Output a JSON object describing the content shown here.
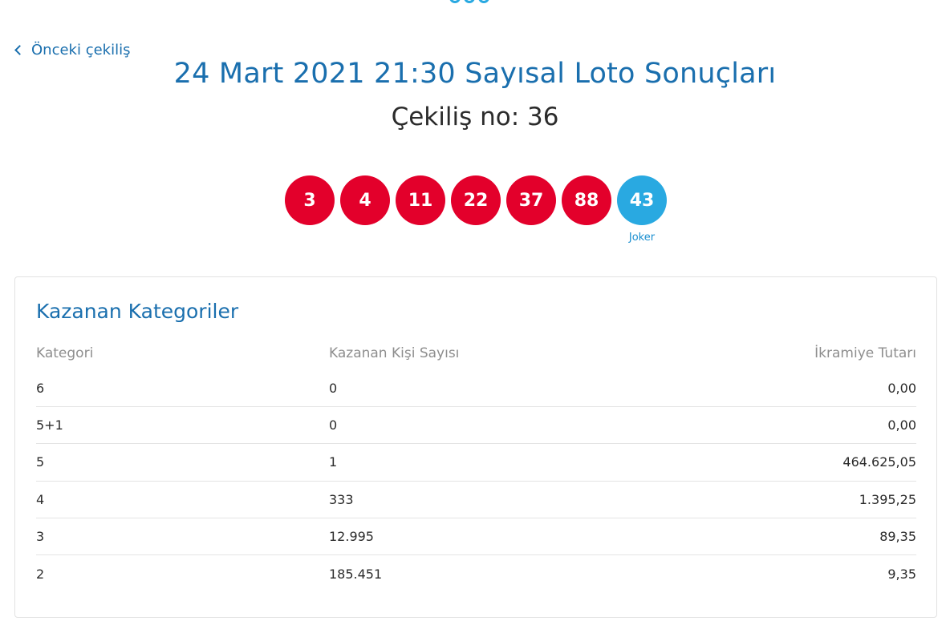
{
  "nav": {
    "back_label": "Önceki çekiliş"
  },
  "header": {
    "title": "24 Mart 2021 21:30 Sayısal Loto Sonuçları",
    "draw_number": "Çekiliş no: 36"
  },
  "numbers": {
    "main": [
      "3",
      "4",
      "11",
      "22",
      "37",
      "88"
    ],
    "joker": "43",
    "joker_label": "Joker"
  },
  "winners": {
    "title": "Kazanan Kategoriler",
    "columns": [
      "Kategori",
      "Kazanan Kişi Sayısı",
      "İkramiye Tutarı"
    ],
    "rows": [
      {
        "category": "6",
        "winners": "0",
        "prize": "0,00"
      },
      {
        "category": "5+1",
        "winners": "0",
        "prize": "0,00"
      },
      {
        "category": "5",
        "winners": "1",
        "prize": "464.625,05"
      },
      {
        "category": "4",
        "winners": "333",
        "prize": "1.395,25"
      },
      {
        "category": "3",
        "winners": "12.995",
        "prize": "89,35"
      },
      {
        "category": "2",
        "winners": "185.451",
        "prize": "9,35"
      }
    ]
  },
  "colors": {
    "primary_blue": "#1a6fae",
    "ball_red": "#e3002b",
    "joker_blue": "#29a9e1"
  }
}
